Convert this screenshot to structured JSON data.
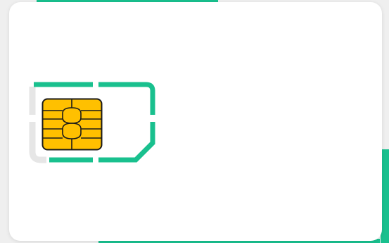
{
  "colors": {
    "accent": "#19c08e",
    "frame_grey": "#e6e6e6",
    "chip_gold": "#ffc000",
    "chip_outline": "#1a1a1a",
    "card": "#ffffff",
    "background": "#efefef"
  },
  "icons": {
    "sim_card": "sim-card-icon",
    "chip": "chip-icon"
  }
}
